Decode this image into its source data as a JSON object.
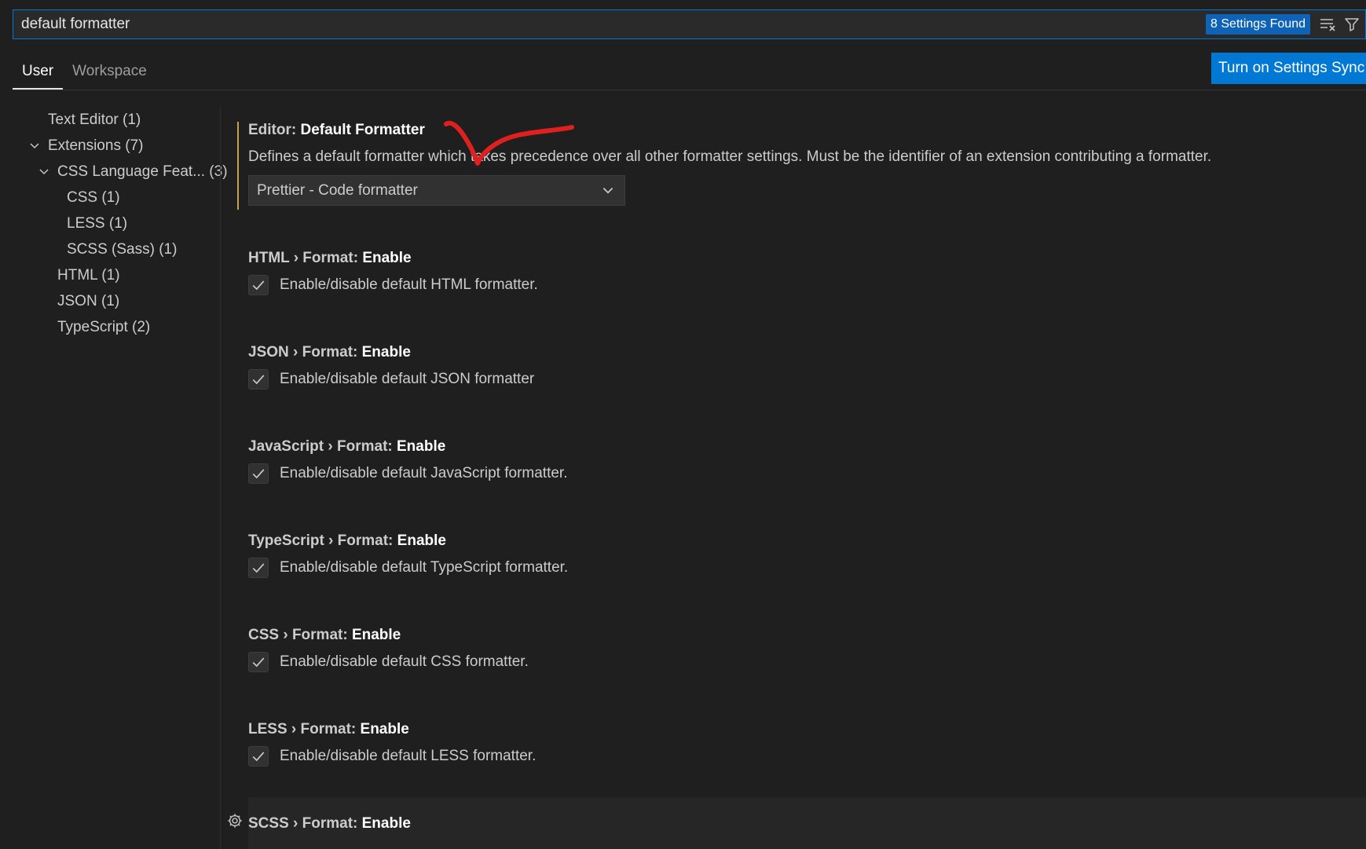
{
  "search": {
    "value": "default formatter",
    "results_badge": "8 Settings Found",
    "clear_icon": "clear-filter-icon",
    "filter_icon": "filter-icon"
  },
  "tabs": [
    {
      "label": "User",
      "active": true
    },
    {
      "label": "Workspace",
      "active": false
    }
  ],
  "sync_button": "Turn on Settings Sync",
  "toc": [
    {
      "label": "Text Editor (1)",
      "chevron": false
    },
    {
      "label": "Extensions (7)",
      "chevron": true
    },
    {
      "label": "CSS Language Feat... (3)",
      "chevron": true
    },
    {
      "label": "CSS (1)",
      "chevron": false
    },
    {
      "label": "LESS (1)",
      "chevron": false
    },
    {
      "label": "SCSS (Sass) (1)",
      "chevron": false
    },
    {
      "label": "HTML (1)",
      "chevron": false
    },
    {
      "label": "JSON (1)",
      "chevron": false
    },
    {
      "label": "TypeScript (2)",
      "chevron": false
    }
  ],
  "settings": {
    "default_formatter": {
      "category": "Editor: ",
      "key": "Default Formatter",
      "description": "Defines a default formatter which takes precedence over all other formatter settings. Must be the identifier of an extension contributing a formatter.",
      "value": "Prettier - Code formatter"
    },
    "html": {
      "category": "HTML › Format: ",
      "key": "Enable",
      "description": "Enable/disable default HTML formatter.",
      "checked": true
    },
    "json": {
      "category": "JSON › Format: ",
      "key": "Enable",
      "description": "Enable/disable default JSON formatter",
      "checked": true
    },
    "javascript": {
      "category": "JavaScript › Format: ",
      "key": "Enable",
      "description": "Enable/disable default JavaScript formatter.",
      "checked": true
    },
    "typescript": {
      "category": "TypeScript › Format: ",
      "key": "Enable",
      "description": "Enable/disable default TypeScript formatter.",
      "checked": true
    },
    "css": {
      "category": "CSS › Format: ",
      "key": "Enable",
      "description": "Enable/disable default CSS formatter.",
      "checked": true
    },
    "less": {
      "category": "LESS › Format: ",
      "key": "Enable",
      "description": "Enable/disable default LESS formatter.",
      "checked": true
    },
    "scss": {
      "category": "SCSS › Format: ",
      "key": "Enable"
    }
  },
  "colors": {
    "accent": "#0078d4",
    "badge": "#0e63b7",
    "focus_bar": "#c5a04f",
    "annotation": "#e0201e"
  }
}
